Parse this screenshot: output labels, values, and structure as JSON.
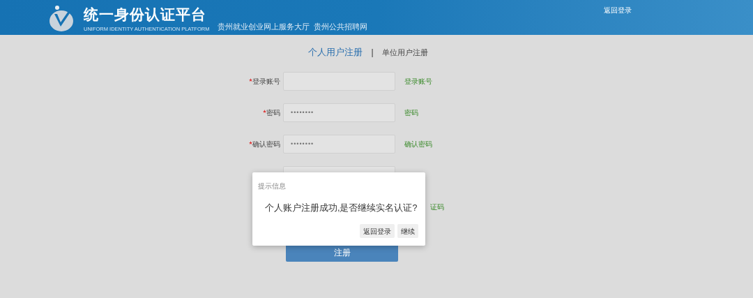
{
  "header": {
    "title": "统一身份认证平台",
    "subtitle": "UNIFORM IDENTITY AUTHENTICATION PLATFORM",
    "links": [
      "贵州就业创业网上服务大厅",
      "贵州公共招聘网"
    ],
    "back_link": "返回登录"
  },
  "tabs": [
    {
      "label": "个人用户注册",
      "selected": true
    },
    {
      "label": "单位用户注册",
      "selected": false
    }
  ],
  "tab_separator": "|",
  "form": {
    "fields": [
      {
        "kind": "text",
        "required": true,
        "label": "登录账号",
        "hint": "登录账号"
      },
      {
        "kind": "password",
        "required": true,
        "label": "密码",
        "value": "••••••••",
        "hint": "密码"
      },
      {
        "kind": "password",
        "required": true,
        "label": "确认密码",
        "value": "••••••••",
        "hint": "确认密码"
      },
      {
        "kind": "covered"
      },
      {
        "kind": "captcha",
        "hint": "证码"
      }
    ],
    "submit": "注册"
  },
  "dialog": {
    "title": "提示信息",
    "message": "个人账户注册成功,是否继续实名认证?",
    "buttons": [
      "返回登录",
      "继续"
    ]
  }
}
